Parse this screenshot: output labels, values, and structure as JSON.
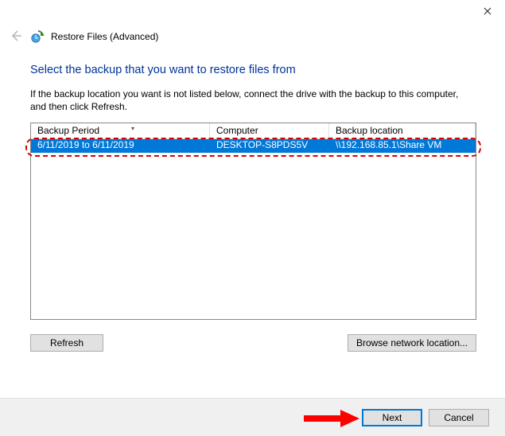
{
  "header": {
    "title": "Restore Files (Advanced)"
  },
  "page": {
    "heading": "Select the backup that you want to restore files from",
    "instruction": "If the backup location you want is not listed below, connect the drive with the backup to this computer, and then click Refresh."
  },
  "list": {
    "columns": {
      "period": "Backup Period",
      "computer": "Computer",
      "location": "Backup location"
    },
    "rows": [
      {
        "period": "6/11/2019 to 6/11/2019",
        "computer": "DESKTOP-S8PDS5V",
        "location": "\\\\192.168.85.1\\Share VM"
      }
    ]
  },
  "buttons": {
    "refresh": "Refresh",
    "browse": "Browse network location...",
    "next": "Next",
    "cancel": "Cancel"
  }
}
